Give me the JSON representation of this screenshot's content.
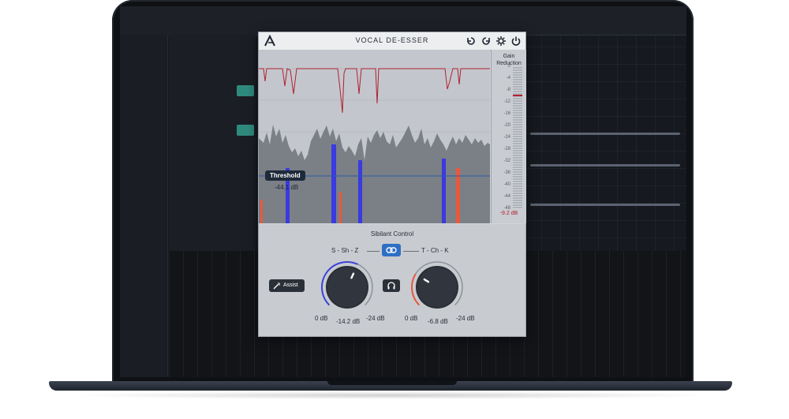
{
  "plugin": {
    "title": "VOCAL DE-ESSER",
    "header_icons": [
      "undo-icon",
      "redo-icon",
      "gear-icon",
      "power-icon"
    ]
  },
  "gain_reduction": {
    "title_line1": "Gain",
    "title_line2": "Reduction",
    "scale": [
      "0",
      "-4",
      "-8",
      "-12",
      "-16",
      "-20",
      "-24",
      "-28",
      "-32",
      "-36",
      "-40",
      "-44",
      "-48"
    ],
    "value": "-9.2 dB",
    "level_db": -9.2
  },
  "threshold": {
    "label": "Threshold",
    "value": "-44.1 dB"
  },
  "sibilant_control": {
    "title": "Sibilant Control",
    "band_left": "S - Sh - Z",
    "band_right": "T - Ch - K",
    "assist_label": "Assist",
    "knob_left": {
      "min": "0 dB",
      "value": "-14.2 dB",
      "max": "-24 dB",
      "amount": -14.2,
      "color": "#3d44d8"
    },
    "knob_right": {
      "min": "0 dB",
      "value": "-6.8 dB",
      "max": "-24 dB",
      "amount": -6.8,
      "color": "#e8583c"
    }
  },
  "colors": {
    "accent": "#2e6fc4",
    "detection_blue": "#3a3ae0",
    "detection_orange": "#e8583c",
    "reduction_curve": "#b02030"
  }
}
